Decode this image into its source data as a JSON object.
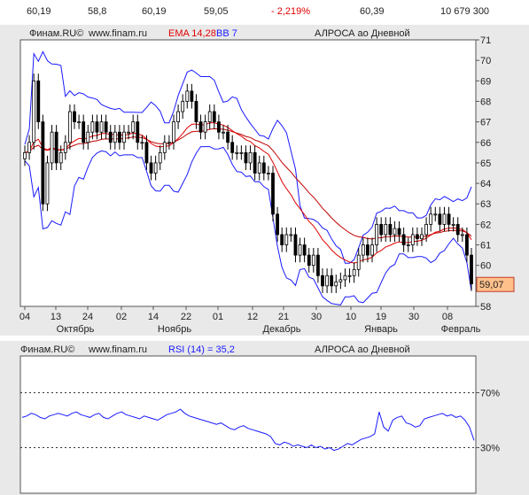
{
  "quote": {
    "open": "60,19",
    "low": "58,8",
    "prev": "60,19",
    "last": "59,05",
    "change": "- 2,219%",
    "high": "60,39",
    "volume": "10 679 300",
    "change_color": "#e00000"
  },
  "price_panel": {
    "source": "Финам.RU©",
    "site": "www.finam.ru",
    "ema_label": "EMA 14,28",
    "bb_label": "BB 7",
    "title": "АЛРОСА ао Дневной",
    "last_price_label": "59,07",
    "y_ticks": [
      "71",
      "70",
      "69",
      "68",
      "67",
      "66",
      "65",
      "64",
      "63",
      "62",
      "61",
      "60",
      "59",
      "58"
    ],
    "x_day_labels": [
      "04",
      "13",
      "24",
      "02",
      "14",
      "22",
      "01",
      "12",
      "21",
      "30",
      "10",
      "19",
      "30",
      "08"
    ],
    "x_month_labels": [
      "Октябрь",
      "Ноябрь",
      "Декабрь",
      "Январь",
      "Февраль"
    ]
  },
  "rsi_panel": {
    "source": "Финам.RU©",
    "site": "www.finam.ru",
    "rsi_label": "RSI (14) = 35,2",
    "title": "АЛРОСА ао Дневной",
    "levels": [
      "70%",
      "30%"
    ]
  },
  "colors": {
    "panel_bg": "#e9e9e9",
    "plot_bg": "#ffffff",
    "ema_fast": "#e00000",
    "ema_slow": "#c00000",
    "bollinger": "#1a1aff",
    "rsi": "#1a1aff",
    "label_box": "#ffc08a"
  },
  "chart_data": [
    {
      "type": "candlestick",
      "ylim": [
        58,
        71
      ],
      "last_price": 59.07,
      "series": [
        {
          "name": "EMA 14,28",
          "values": []
        },
        {
          "name": "BB 7",
          "values": []
        }
      ],
      "close": [
        65.5,
        66,
        69,
        67,
        63,
        65,
        66.5,
        65,
        65.5,
        66,
        67.5,
        67,
        67,
        66,
        66.5,
        67,
        66.5,
        67,
        66.5,
        66,
        66.5,
        66,
        66.5,
        66.5,
        67,
        66,
        66,
        65,
        64.5,
        65,
        65.5,
        66,
        66,
        67,
        67.5,
        68,
        68.5,
        68,
        67,
        66.5,
        67,
        67.5,
        67,
        66.5,
        66.5,
        66,
        65.5,
        65.5,
        65.5,
        65,
        65.5,
        64.5,
        65,
        64.5,
        64.5,
        62.5,
        61.5,
        61,
        61.5,
        61.5,
        60.5,
        61,
        60.5,
        60,
        60.5,
        59.5,
        59,
        59.5,
        59,
        59.2,
        59.3,
        59.5,
        59.5,
        59.8,
        60.5,
        61,
        60.5,
        61,
        62,
        61.5,
        62,
        61.5,
        61.8,
        61.5,
        61,
        61,
        61.5,
        61.3,
        61.5,
        62,
        62.5,
        62.5,
        62,
        62.5,
        62,
        62,
        61.5,
        61.5,
        60.5,
        59.1
      ],
      "rsi": [
        52,
        53,
        55,
        54,
        52,
        51,
        53,
        54,
        55,
        54,
        53,
        55,
        56,
        54,
        53,
        52,
        54,
        55,
        52,
        51,
        53,
        55,
        56,
        54,
        53,
        52,
        51,
        53,
        52,
        51,
        50,
        52,
        54,
        55,
        56,
        58,
        55,
        53,
        52,
        51,
        50,
        49,
        48,
        47,
        48,
        46,
        44,
        43,
        45,
        46,
        44,
        43,
        42,
        41,
        40,
        38,
        33,
        32,
        34,
        33,
        31,
        32,
        31,
        30,
        32,
        30,
        31,
        29,
        30,
        28,
        29,
        31,
        33,
        32,
        34,
        36,
        37,
        38,
        40,
        56,
        45,
        42,
        50,
        52,
        53,
        48,
        47,
        45,
        46,
        51,
        52,
        53,
        54,
        55,
        53,
        54,
        52,
        53,
        50,
        45,
        35.2
      ]
    }
  ]
}
